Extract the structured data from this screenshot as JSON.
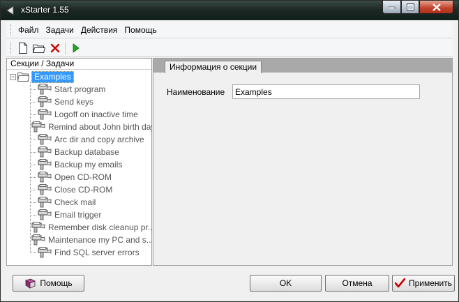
{
  "window": {
    "title": "xStarter 1.55"
  },
  "menu": {
    "items": [
      "Файл",
      "Задачи",
      "Действия",
      "Помощь"
    ]
  },
  "toolbar": {
    "icons": [
      "new-file-icon",
      "open-folder-icon",
      "delete-icon",
      "run-icon"
    ]
  },
  "tree": {
    "header": "Секции / Задачи",
    "root_label": "Examples",
    "items": [
      "Start program",
      "Send keys",
      "Logoff on inactive time",
      "Remind about John birth day",
      "Arc dir and copy archive",
      "Backup database",
      "Backup my emails",
      "Open CD-ROM",
      "Close CD-ROM",
      "Check mail",
      "Email trigger",
      "Remember disk cleanup pr...",
      "Maintenance my PC and s...",
      "Find SQL server errors"
    ]
  },
  "section_panel": {
    "tab_label": "Информация о секции",
    "name_label": "Наименование",
    "name_value": "Examples"
  },
  "buttons": {
    "help": "Помощь",
    "ok": "OK",
    "cancel": "Отмена",
    "apply": "Применить"
  },
  "colors": {
    "selection": "#3399ff",
    "close_button": "#c0402a",
    "run_icon": "#22aa22",
    "delete_icon": "#cc0000"
  }
}
